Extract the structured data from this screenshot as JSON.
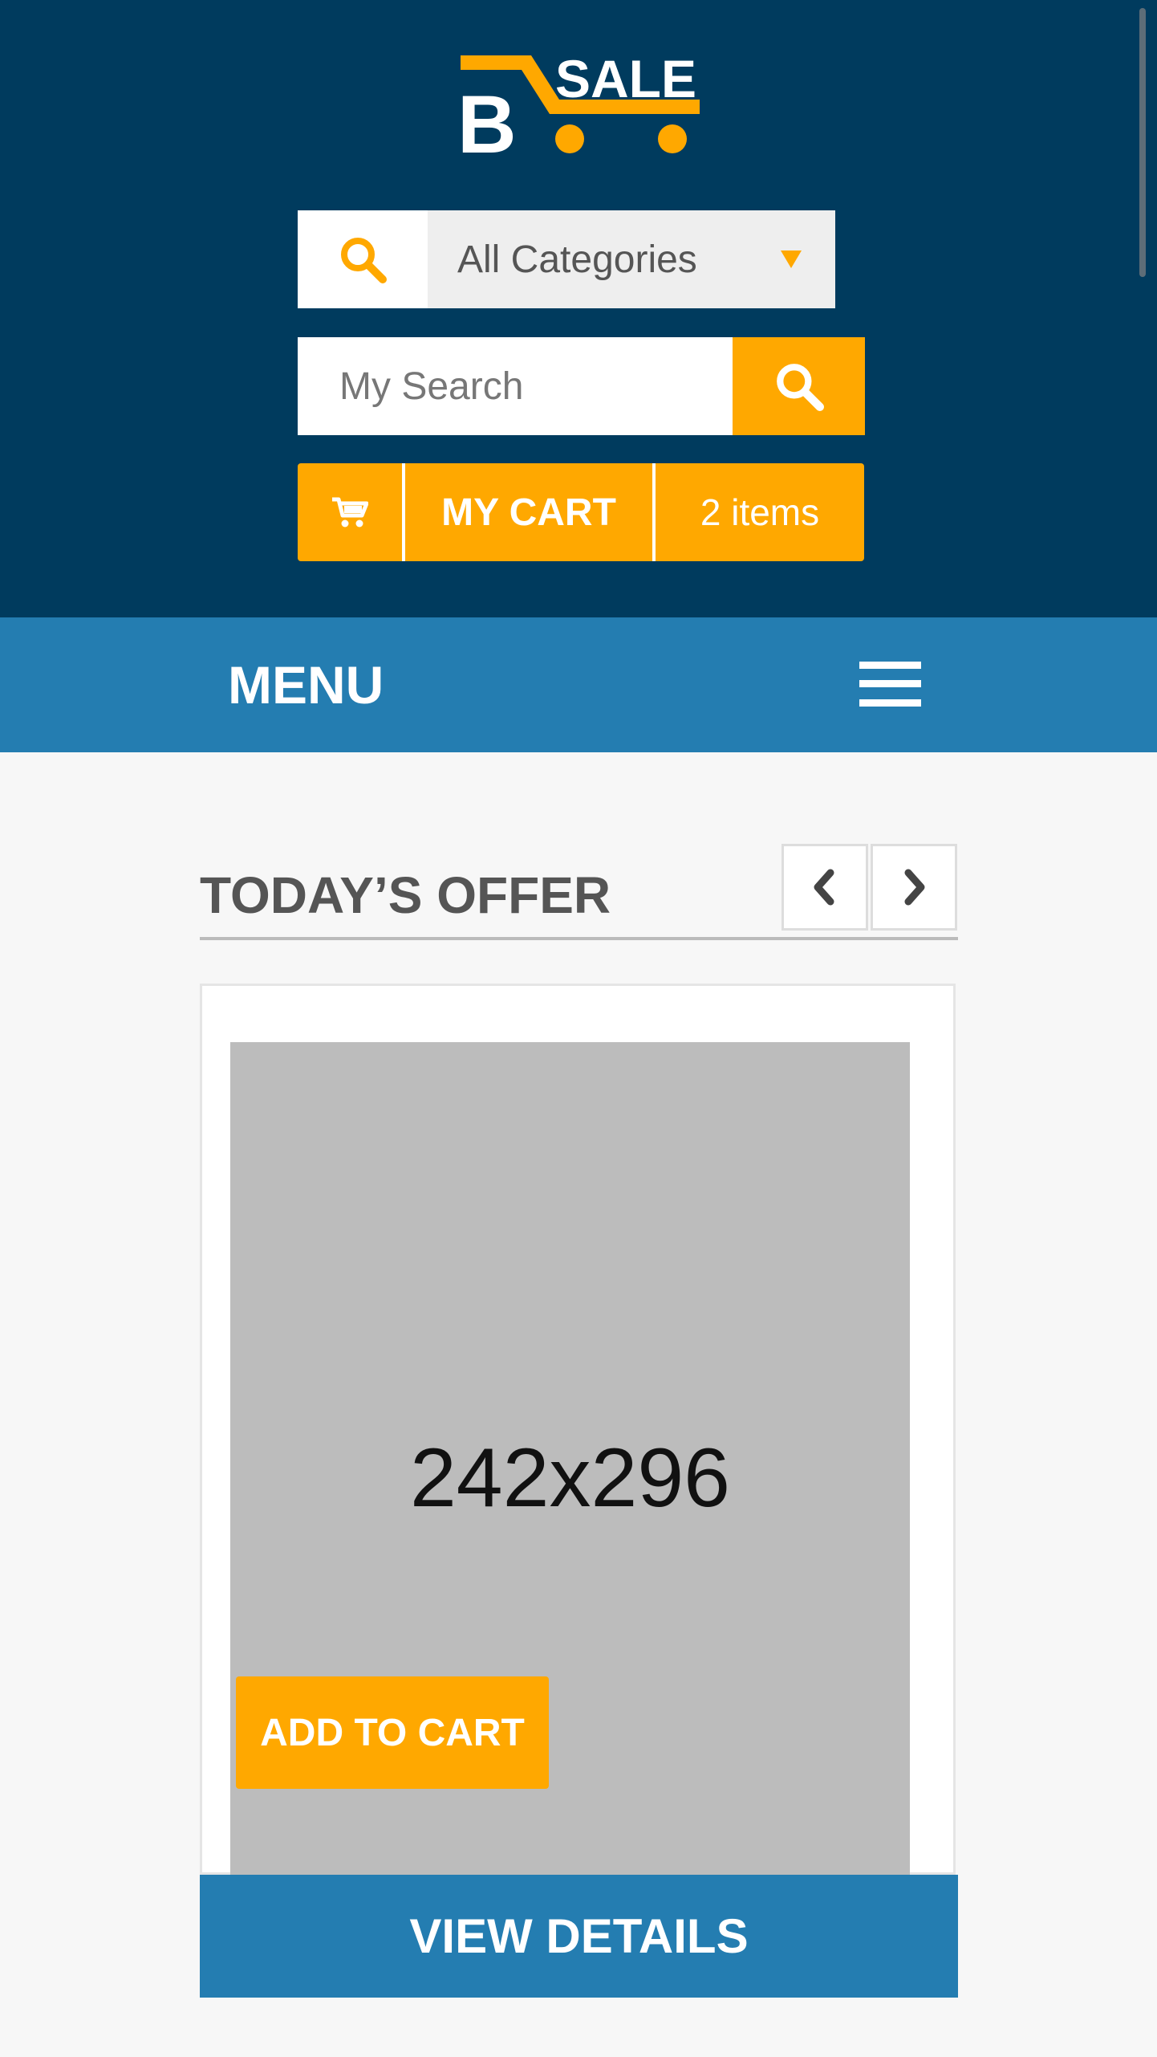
{
  "brand": {
    "logo_letter": "B",
    "logo_text": "SALE"
  },
  "header": {
    "category_select": {
      "value": "All Categories"
    },
    "search": {
      "placeholder": "My Search"
    },
    "cart": {
      "label": "MY CART",
      "count": "2 items"
    }
  },
  "menu": {
    "label": "MENU"
  },
  "offer": {
    "title": "TODAY’S OFFER",
    "product": {
      "image_placeholder": "242x296",
      "add_to_cart_label": "ADD TO CART",
      "view_details_label": "VIEW DETAILS"
    }
  },
  "icons": {
    "category_search": "search-icon",
    "search_button": "search-icon",
    "cart": "cart-icon",
    "menu": "hamburger-icon",
    "prev": "chevron-left-icon",
    "next": "chevron-right-icon"
  },
  "colors": {
    "header_bg": "#003b5e",
    "menu_bg": "#247db1",
    "accent": "#ffa800",
    "page_bg": "#f7f7f7"
  }
}
